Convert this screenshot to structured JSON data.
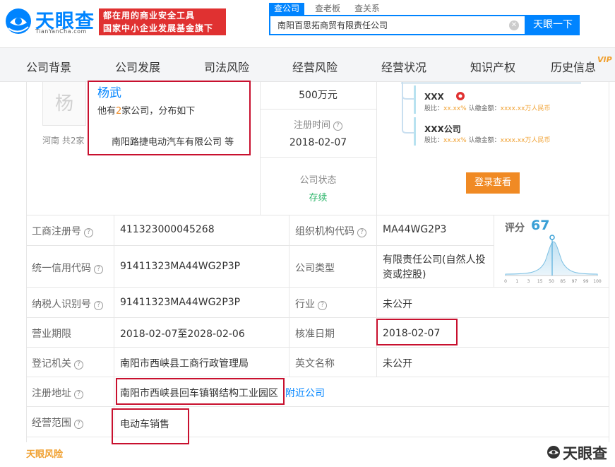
{
  "brand": {
    "name": "天眼查",
    "domain": "TianYanCha.com",
    "slogan_line1": "都在用的商业安全工具",
    "slogan_line2": "国家中小企业发展基金旗下",
    "color": "#0084ff"
  },
  "search": {
    "tabs": [
      {
        "label": "查公司",
        "active": true
      },
      {
        "label": "查老板",
        "active": false
      },
      {
        "label": "查关系",
        "active": false
      }
    ],
    "value": "南阳百思拓商贸有限责任公司",
    "button_label": "天眼一下"
  },
  "nav": {
    "items": [
      "公司背景",
      "公司发展",
      "司法风险",
      "经营风险",
      "经营状况",
      "知识产权",
      "历史信息"
    ],
    "vip_badge": "VIP"
  },
  "legal_rep": {
    "avatar_char": "杨",
    "name": "杨武",
    "other_companies_prefix": "他有",
    "other_companies_count": "2",
    "other_companies_suffix": "家公司，分布如下",
    "region_text": "河南  共2家",
    "company_text": "南阳路捷电动汽车有限公司 等"
  },
  "capital": {
    "value": "500万元"
  },
  "reg_time": {
    "label": "注册时间",
    "value": "2018-02-07"
  },
  "status": {
    "label": "公司状态",
    "value": "存续"
  },
  "shareholders": [
    {
      "name": "XXX",
      "ratio_label": "股比：",
      "ratio": "xx.xx%",
      "amount_label": "认缴金额：",
      "amount": "xxxx.xx万人民币"
    },
    {
      "name": "XXX公司",
      "ratio_label": "股比：",
      "ratio": "xx.xx%",
      "amount_label": "认缴金额：",
      "amount": "xxxx.xx万人民币"
    }
  ],
  "login_button": "登录查看",
  "table": {
    "reg_no_label": "工商注册号",
    "reg_no": "411323000045268",
    "org_code_label": "组织机构代码",
    "org_code": "MA44WG2P3",
    "credit_code_label": "统一信用代码",
    "credit_code": "91411323MA44WG2P3P",
    "company_type_label": "公司类型",
    "company_type_line1": "有限责任公司(自然人投",
    "company_type_line2": "资或控股)",
    "taxpayer_label": "纳税人识别号",
    "taxpayer": "91411323MA44WG2P3P",
    "industry_label": "行业",
    "industry": "未公开",
    "term_label": "营业期限",
    "term": "2018-02-07至2028-02-06",
    "approve_label": "核准日期",
    "approve": "2018-02-07",
    "authority_label": "登记机关",
    "authority": "南阳市西峡县工商行政管理局",
    "english_label": "英文名称",
    "english": "未公开",
    "address_label": "注册地址",
    "address": "南阳市西峡县回车镇钢结构工业园区",
    "nearby": "附近公司",
    "scope_label": "经营范围",
    "scope": "电动车销售"
  },
  "score": {
    "label": "评分",
    "value": "67",
    "value_num": 67,
    "ticks": [
      "0",
      "1",
      "3",
      "15",
      "50",
      "85",
      "97",
      "99",
      "100"
    ],
    "color": "#3aa0d6"
  },
  "footer": {
    "left": "天眼风险",
    "logo": "天眼查"
  }
}
